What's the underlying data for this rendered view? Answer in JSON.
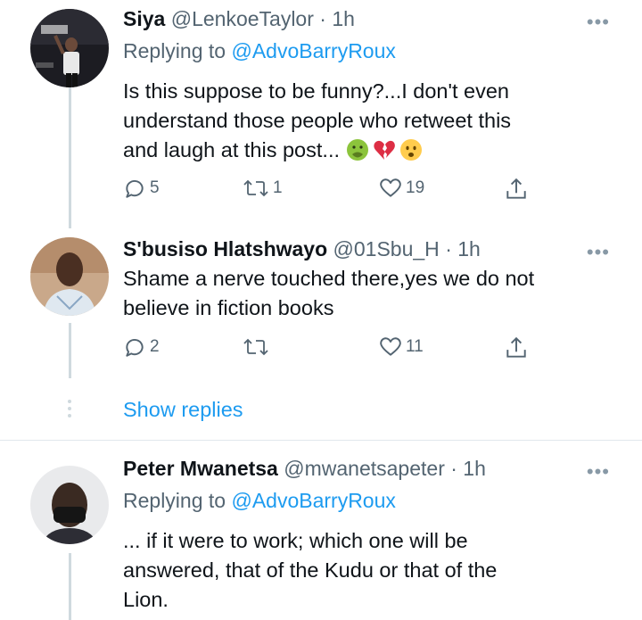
{
  "tweets": [
    {
      "name": "Siya",
      "handle": "@LenkoeTaylor",
      "time": "· 1h",
      "replying_prefix": "Replying to",
      "replying_to": "@AdvoBarryRoux",
      "lines": [
        "Is this suppose to be funny?...I don't even",
        "understand those people who retweet this",
        "and laugh at this post..."
      ],
      "emojis": [
        "nauseated-face",
        "broken-heart",
        "frowning-face"
      ],
      "reply_count": "5",
      "retweet_count": "1",
      "like_count": "19"
    },
    {
      "name": "S'busiso Hlatshwayo",
      "handle": "@01Sbu_H",
      "time": "· 1h",
      "lines": [
        "Shame a nerve touched there,yes we do not",
        "believe in fiction books"
      ],
      "reply_count": "2",
      "retweet_count": "",
      "like_count": "11"
    },
    {
      "name": "Peter Mwanetsa",
      "handle": "@mwanetsapeter",
      "time": "· 1h",
      "replying_prefix": "Replying to",
      "replying_to": "@AdvoBarryRoux",
      "lines": [
        "... if it were to work; which one will be",
        "answered, that of the Kudu or that of the",
        "Lion."
      ]
    }
  ],
  "show_replies": "Show replies",
  "more_icon": "•••",
  "colors": {
    "link": "#1d9bf0",
    "secondary": "#536471",
    "thread_line": "#cfd9de"
  }
}
